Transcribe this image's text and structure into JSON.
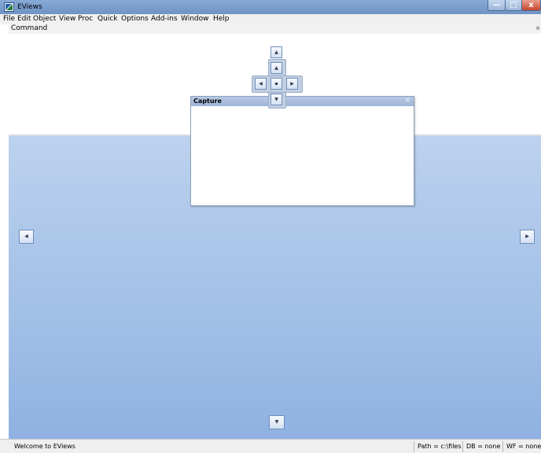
{
  "window": {
    "title": "EViews"
  },
  "menu": [
    "File",
    "Edit",
    "Object",
    "View",
    "Proc",
    "Quick",
    "Options",
    "Add-ins",
    "Window",
    "Help"
  ],
  "command_pane": {
    "label": "Command",
    "pin_icon": "pin-icon"
  },
  "capture_pane": {
    "title": "Capture",
    "close_glyph": "×"
  },
  "dock_glyphs": {
    "up": "▲",
    "down": "▼",
    "left": "◀",
    "right": "▶",
    "center": "▪"
  },
  "status_bar": {
    "message": "Welcome to EViews",
    "path": "Path = c:\\files",
    "db": "DB = none",
    "wf": "WF = none"
  },
  "window_controls": {
    "minimize": "—",
    "maximize": "□",
    "close": "x"
  }
}
